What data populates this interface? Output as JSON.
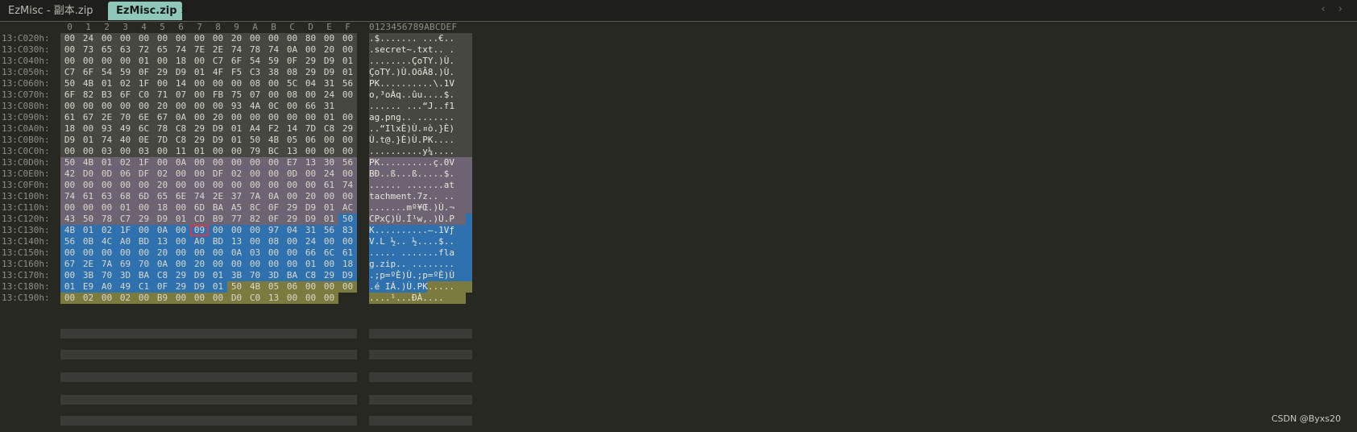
{
  "tabs": [
    {
      "label": "EzMisc - 副本.zip",
      "active": false
    },
    {
      "label": "EzMisc.zip",
      "active": true,
      "close": "×"
    }
  ],
  "nav_arrows": "‹ ›",
  "hex": {
    "column_headers": [
      "0",
      "1",
      "2",
      "3",
      "4",
      "5",
      "6",
      "7",
      "8",
      "9",
      "A",
      "B",
      "C",
      "D",
      "E",
      "F"
    ],
    "ascii_header": "0123456789ABCDEF",
    "rows": [
      {
        "addr": "13:C020h:",
        "bytes": [
          "00",
          "24",
          "00",
          "00",
          "00",
          "00",
          "00",
          "00",
          "00",
          "20",
          "00",
          "00",
          "00",
          "80",
          "00",
          "00"
        ],
        "ascii": ".$....... ...€.."
      },
      {
        "addr": "13:C030h:",
        "bytes": [
          "00",
          "73",
          "65",
          "63",
          "72",
          "65",
          "74",
          "7E",
          "2E",
          "74",
          "78",
          "74",
          "0A",
          "00",
          "20",
          "00"
        ],
        "ascii": ".secret~.txt.. ."
      },
      {
        "addr": "13:C040h:",
        "bytes": [
          "00",
          "00",
          "00",
          "00",
          "01",
          "00",
          "18",
          "00",
          "C7",
          "6F",
          "54",
          "59",
          "0F",
          "29",
          "D9",
          "01"
        ],
        "ascii": "........ÇoTY.)Ù."
      },
      {
        "addr": "13:C050h:",
        "bytes": [
          "C7",
          "6F",
          "54",
          "59",
          "0F",
          "29",
          "D9",
          "01",
          "4F",
          "F5",
          "C3",
          "38",
          "08",
          "29",
          "D9",
          "01"
        ],
        "ascii": "ÇoTY.)Ù.OõÃ8.)Ù."
      },
      {
        "addr": "13:C060h:",
        "bytes": [
          "50",
          "4B",
          "01",
          "02",
          "1F",
          "00",
          "14",
          "00",
          "00",
          "00",
          "08",
          "00",
          "5C",
          "04",
          "31",
          "56"
        ],
        "ascii": "PK..........\\.1V"
      },
      {
        "addr": "13:C070h:",
        "bytes": [
          "6F",
          "82",
          "B3",
          "6F",
          "C0",
          "71",
          "07",
          "00",
          "FB",
          "75",
          "07",
          "00",
          "08",
          "00",
          "24",
          "00"
        ],
        "ascii": "o‚³oÀq..ûu....$."
      },
      {
        "addr": "13:C080h:",
        "bytes": [
          "00",
          "00",
          "00",
          "00",
          "00",
          "20",
          "00",
          "00",
          "00",
          "93",
          "4A",
          "0C",
          "00",
          "66",
          "31"
        ],
        "ascii": "...... ...“J..f1"
      },
      {
        "addr": "13:C090h:",
        "bytes": [
          "61",
          "67",
          "2E",
          "70",
          "6E",
          "67",
          "0A",
          "00",
          "20",
          "00",
          "00",
          "00",
          "00",
          "00",
          "01",
          "00"
        ],
        "ascii": "ag.png.. ......."
      },
      {
        "addr": "13:C0A0h:",
        "bytes": [
          "18",
          "00",
          "93",
          "49",
          "6C",
          "78",
          "C8",
          "29",
          "D9",
          "01",
          "A4",
          "F2",
          "14",
          "7D",
          "C8",
          "29"
        ],
        "ascii": "..“IlxÈ)Ù.¤ò.}È)"
      },
      {
        "addr": "13:C0B0h:",
        "bytes": [
          "D9",
          "01",
          "74",
          "40",
          "0E",
          "7D",
          "C8",
          "29",
          "D9",
          "01",
          "50",
          "4B",
          "05",
          "06",
          "00",
          "00"
        ],
        "ascii": "Ù.t@.}È)Ù.PK...."
      },
      {
        "addr": "13:C0C0h:",
        "bytes": [
          "00",
          "00",
          "03",
          "00",
          "03",
          "00",
          "11",
          "01",
          "00",
          "00",
          "79",
          "BC",
          "13",
          "00",
          "00",
          "00"
        ],
        "ascii": "..........y¼...."
      },
      {
        "addr": "13:C0D0h:",
        "bytes": [
          "50",
          "4B",
          "01",
          "02",
          "1F",
          "00",
          "0A",
          "00",
          "00",
          "00",
          "00",
          "00",
          "E7",
          "13",
          "30",
          "56"
        ],
        "ascii": "PK..........ç.0V"
      },
      {
        "addr": "13:C0E0h:",
        "bytes": [
          "42",
          "D0",
          "0D",
          "06",
          "DF",
          "02",
          "00",
          "00",
          "DF",
          "02",
          "00",
          "00",
          "0D",
          "00",
          "24",
          "00"
        ],
        "ascii": "BÐ..ß...ß.....$."
      },
      {
        "addr": "13:C0F0h:",
        "bytes": [
          "00",
          "00",
          "00",
          "00",
          "00",
          "20",
          "00",
          "00",
          "00",
          "00",
          "00",
          "00",
          "00",
          "00",
          "61",
          "74"
        ],
        "ascii": "...... .......at"
      },
      {
        "addr": "13:C100h:",
        "bytes": [
          "74",
          "61",
          "63",
          "68",
          "6D",
          "65",
          "6E",
          "74",
          "2E",
          "37",
          "7A",
          "0A",
          "00",
          "20",
          "00",
          "00"
        ],
        "ascii": "tachment.7z.. .."
      },
      {
        "addr": "13:C110h:",
        "bytes": [
          "00",
          "00",
          "00",
          "01",
          "00",
          "18",
          "00",
          "6D",
          "BA",
          "A5",
          "8C",
          "0F",
          "29",
          "D9",
          "01",
          "AC"
        ],
        "ascii": ".......mº¥Œ.)Ù.¬"
      },
      {
        "addr": "13:C120h:",
        "bytes": [
          "43",
          "50",
          "78",
          "C7",
          "29",
          "D9",
          "01",
          "CD",
          "B9",
          "77",
          "82",
          "0F",
          "29",
          "D9",
          "01",
          "50"
        ],
        "ascii": "CPxÇ)Ù.Í¹w‚.)Ù.P"
      },
      {
        "addr": "13:C130h:",
        "bytes": [
          "4B",
          "01",
          "02",
          "1F",
          "00",
          "0A",
          "00",
          "09",
          "00",
          "00",
          "00",
          "97",
          "04",
          "31",
          "56",
          "83"
        ],
        "ascii": "K..........—.1Vƒ"
      },
      {
        "addr": "13:C140h:",
        "bytes": [
          "56",
          "0B",
          "4C",
          "A0",
          "BD",
          "13",
          "00",
          "A0",
          "BD",
          "13",
          "00",
          "08",
          "00",
          "24",
          "00",
          "00"
        ],
        "ascii": "V.L ½.. ½....$.."
      },
      {
        "addr": "13:C150h:",
        "bytes": [
          "00",
          "00",
          "00",
          "00",
          "00",
          "20",
          "00",
          "00",
          "00",
          "0A",
          "03",
          "00",
          "00",
          "66",
          "6C",
          "61"
        ],
        "ascii": "..... .......fla"
      },
      {
        "addr": "13:C160h:",
        "bytes": [
          "67",
          "2E",
          "7A",
          "69",
          "70",
          "0A",
          "00",
          "20",
          "00",
          "00",
          "00",
          "00",
          "00",
          "01",
          "00",
          "18"
        ],
        "ascii": "g.zip.. ........"
      },
      {
        "addr": "13:C170h:",
        "bytes": [
          "00",
          "3B",
          "70",
          "3D",
          "BA",
          "C8",
          "29",
          "D9",
          "01",
          "3B",
          "70",
          "3D",
          "BA",
          "C8",
          "29",
          "D9"
        ],
        "ascii": ".;p=ºÈ)Ù.;p=ºÈ)Ù"
      },
      {
        "addr": "13:C180h:",
        "bytes": [
          "01",
          "E9",
          "A0",
          "49",
          "C1",
          "0F",
          "29",
          "D9",
          "01",
          "50",
          "4B",
          "05",
          "06",
          "00",
          "00",
          "00"
        ],
        "ascii": ".é IÁ.)Ù.PK....."
      },
      {
        "addr": "13:C190h:",
        "bytes": [
          "00",
          "02",
          "00",
          "02",
          "00",
          "B9",
          "00",
          "00",
          "00",
          "D0",
          "C0",
          "13",
          "00",
          "00",
          "00"
        ],
        "ascii": "....¹...ÐÀ...."
      }
    ]
  },
  "highlight_colors": {
    "gray": "#464741",
    "purple": "#6e6373",
    "blue": "#2e71ae",
    "olive": "#7c7b3f",
    "selection_border": "#d63a47"
  },
  "watermark": "CSDN @Byxs20"
}
